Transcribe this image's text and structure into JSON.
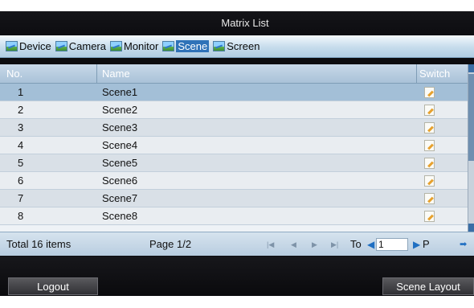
{
  "window": {
    "title": "Matrix List"
  },
  "tabs": [
    {
      "label": "Device",
      "icon": "image-icon",
      "active": false
    },
    {
      "label": "Camera",
      "icon": "image-icon",
      "active": false
    },
    {
      "label": "Monitor",
      "icon": "image-icon",
      "active": false
    },
    {
      "label": "Scene",
      "icon": "image-icon",
      "active": true
    },
    {
      "label": "Screen",
      "icon": "image-icon",
      "active": false
    }
  ],
  "table": {
    "columns": {
      "no": "No.",
      "name": "Name",
      "switch": "Switch"
    },
    "rows": [
      {
        "no": "1",
        "name": "Scene1",
        "selected": true
      },
      {
        "no": "2",
        "name": "Scene2"
      },
      {
        "no": "3",
        "name": "Scene3"
      },
      {
        "no": "4",
        "name": "Scene4"
      },
      {
        "no": "5",
        "name": "Scene5"
      },
      {
        "no": "6",
        "name": "Scene6"
      },
      {
        "no": "7",
        "name": "Scene7"
      },
      {
        "no": "8",
        "name": "Scene8"
      }
    ],
    "switch_icon": "edit-icon"
  },
  "pager": {
    "total": "Total 16 items",
    "page": "Page 1/2",
    "first_icon": "first-page-icon",
    "prev_icon": "prev-page-icon",
    "next_icon": "next-page-icon",
    "last_icon": "last-page-icon",
    "to_label": "To",
    "page_input": "1",
    "go_label": "P"
  },
  "footer": {
    "logout": "Logout",
    "scene_layout": "Scene Layout"
  },
  "colors": {
    "accent": "#2f72b8",
    "selected_row": "#a3bfd7",
    "header_bg": "#b1cde2"
  }
}
